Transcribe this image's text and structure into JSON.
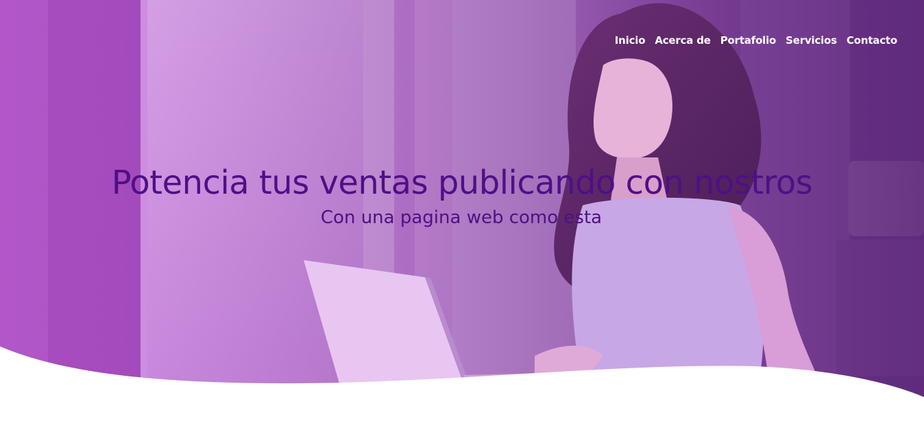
{
  "nav": {
    "items": [
      {
        "label": "Inicio"
      },
      {
        "label": "Acerca de"
      },
      {
        "label": "Portafolio"
      },
      {
        "label": "Servicios"
      },
      {
        "label": "Contacto"
      }
    ]
  },
  "hero": {
    "title": "Potencia tus ventas publicando con nostros",
    "subtitle": "Con una pagina web como esta",
    "overlay_color": "#c06fd6",
    "title_color": "#4f0f85"
  }
}
